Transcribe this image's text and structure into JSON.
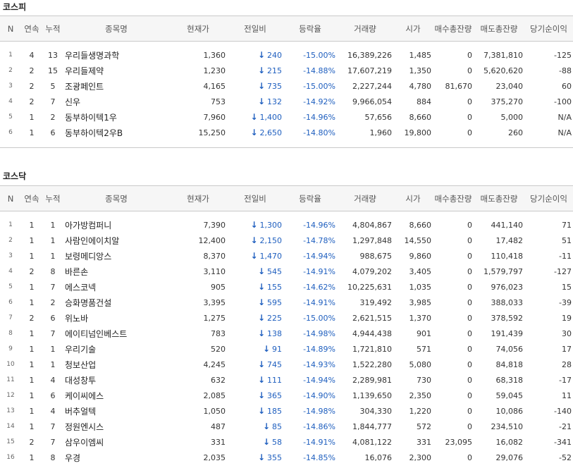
{
  "kospi": {
    "title": "코스피",
    "headers": [
      "N",
      "연속",
      "누적",
      "종목명",
      "현재가",
      "전일비",
      "등락율",
      "거래량",
      "시가",
      "매수총잔량",
      "매도총잔량",
      "당기순이익"
    ],
    "rows": [
      {
        "n": "1",
        "streak": "4",
        "cum": "13",
        "name": "우리들생명과학",
        "price": "1,360",
        "change": "240",
        "rate": "-15.00%",
        "volume": "16,389,226",
        "open": "1,485",
        "bid": "0",
        "ask": "7,381,810",
        "net": "-125"
      },
      {
        "n": "2",
        "streak": "2",
        "cum": "15",
        "name": "우리들제약",
        "price": "1,230",
        "change": "215",
        "rate": "-14.88%",
        "volume": "17,607,219",
        "open": "1,350",
        "bid": "0",
        "ask": "5,620,620",
        "net": "-88"
      },
      {
        "n": "3",
        "streak": "2",
        "cum": "5",
        "name": "조광페인트",
        "price": "4,165",
        "change": "735",
        "rate": "-15.00%",
        "volume": "2,227,244",
        "open": "4,780",
        "bid": "81,670",
        "ask": "23,040",
        "net": "60"
      },
      {
        "n": "4",
        "streak": "2",
        "cum": "7",
        "name": "신우",
        "price": "753",
        "change": "132",
        "rate": "-14.92%",
        "volume": "9,966,054",
        "open": "884",
        "bid": "0",
        "ask": "375,270",
        "net": "-100"
      },
      {
        "n": "5",
        "streak": "1",
        "cum": "2",
        "name": "동부하이텍1우",
        "price": "7,960",
        "change": "1,400",
        "rate": "-14.96%",
        "volume": "57,656",
        "open": "8,660",
        "bid": "0",
        "ask": "5,000",
        "net": "N/A"
      },
      {
        "n": "6",
        "streak": "1",
        "cum": "6",
        "name": "동부하이텍2우B",
        "price": "15,250",
        "change": "2,650",
        "rate": "-14.80%",
        "volume": "1,960",
        "open": "19,800",
        "bid": "0",
        "ask": "260",
        "net": "N/A"
      }
    ]
  },
  "kosdaq": {
    "title": "코스닥",
    "headers": [
      "N",
      "연속",
      "누적",
      "종목명",
      "현재가",
      "전일비",
      "등락율",
      "거래량",
      "시가",
      "매수총잔량",
      "매도총잔량",
      "당기순이익"
    ],
    "rows": [
      {
        "n": "1",
        "streak": "1",
        "cum": "1",
        "name": "아가방컴퍼니",
        "price": "7,390",
        "change": "1,300",
        "rate": "-14.96%",
        "volume": "4,804,867",
        "open": "8,660",
        "bid": "0",
        "ask": "441,140",
        "net": "71"
      },
      {
        "n": "2",
        "streak": "1",
        "cum": "1",
        "name": "사람인에이치알",
        "price": "12,400",
        "change": "2,150",
        "rate": "-14.78%",
        "volume": "1,297,848",
        "open": "14,550",
        "bid": "0",
        "ask": "17,482",
        "net": "51"
      },
      {
        "n": "3",
        "streak": "1",
        "cum": "1",
        "name": "보령메디앙스",
        "price": "8,370",
        "change": "1,470",
        "rate": "-14.94%",
        "volume": "988,675",
        "open": "9,860",
        "bid": "0",
        "ask": "110,418",
        "net": "-11"
      },
      {
        "n": "4",
        "streak": "2",
        "cum": "8",
        "name": "바른손",
        "price": "3,110",
        "change": "545",
        "rate": "-14.91%",
        "volume": "4,079,202",
        "open": "3,405",
        "bid": "0",
        "ask": "1,579,797",
        "net": "-127"
      },
      {
        "n": "5",
        "streak": "1",
        "cum": "7",
        "name": "에스코넥",
        "price": "905",
        "change": "155",
        "rate": "-14.62%",
        "volume": "10,225,631",
        "open": "1,035",
        "bid": "0",
        "ask": "976,023",
        "net": "15"
      },
      {
        "n": "6",
        "streak": "1",
        "cum": "2",
        "name": "승화명품건설",
        "price": "3,395",
        "change": "595",
        "rate": "-14.91%",
        "volume": "319,492",
        "open": "3,985",
        "bid": "0",
        "ask": "388,033",
        "net": "-39"
      },
      {
        "n": "7",
        "streak": "2",
        "cum": "6",
        "name": "위노바",
        "price": "1,275",
        "change": "225",
        "rate": "-15.00%",
        "volume": "2,621,515",
        "open": "1,370",
        "bid": "0",
        "ask": "378,592",
        "net": "19"
      },
      {
        "n": "8",
        "streak": "1",
        "cum": "7",
        "name": "에이티넘인베스트",
        "price": "783",
        "change": "138",
        "rate": "-14.98%",
        "volume": "4,944,438",
        "open": "901",
        "bid": "0",
        "ask": "191,439",
        "net": "30"
      },
      {
        "n": "9",
        "streak": "1",
        "cum": "1",
        "name": "우리기술",
        "price": "520",
        "change": "91",
        "rate": "-14.89%",
        "volume": "1,721,810",
        "open": "571",
        "bid": "0",
        "ask": "74,056",
        "net": "17"
      },
      {
        "n": "10",
        "streak": "1",
        "cum": "1",
        "name": "청보산업",
        "price": "4,245",
        "change": "745",
        "rate": "-14.93%",
        "volume": "1,522,280",
        "open": "5,080",
        "bid": "0",
        "ask": "84,818",
        "net": "28"
      },
      {
        "n": "11",
        "streak": "1",
        "cum": "4",
        "name": "대성창투",
        "price": "632",
        "change": "111",
        "rate": "-14.94%",
        "volume": "2,289,981",
        "open": "730",
        "bid": "0",
        "ask": "68,318",
        "net": "-17"
      },
      {
        "n": "12",
        "streak": "1",
        "cum": "6",
        "name": "케이씨에스",
        "price": "2,085",
        "change": "365",
        "rate": "-14.90%",
        "volume": "1,139,650",
        "open": "2,350",
        "bid": "0",
        "ask": "59,045",
        "net": "11"
      },
      {
        "n": "13",
        "streak": "1",
        "cum": "4",
        "name": "버추얼텍",
        "price": "1,050",
        "change": "185",
        "rate": "-14.98%",
        "volume": "304,330",
        "open": "1,220",
        "bid": "0",
        "ask": "10,086",
        "net": "-140"
      },
      {
        "n": "14",
        "streak": "1",
        "cum": "7",
        "name": "정원엔시스",
        "price": "487",
        "change": "85",
        "rate": "-14.86%",
        "volume": "1,844,777",
        "open": "572",
        "bid": "0",
        "ask": "234,510",
        "net": "-21"
      },
      {
        "n": "15",
        "streak": "2",
        "cum": "7",
        "name": "삼우이엠씨",
        "price": "331",
        "change": "58",
        "rate": "-14.91%",
        "volume": "4,081,122",
        "open": "331",
        "bid": "23,095",
        "ask": "16,082",
        "net": "-341"
      },
      {
        "n": "16",
        "streak": "1",
        "cum": "8",
        "name": "우경",
        "price": "2,035",
        "change": "355",
        "rate": "-14.85%",
        "volume": "16,076",
        "open": "2,300",
        "bid": "0",
        "ask": "29,076",
        "net": "-52"
      }
    ]
  },
  "arrow_color": "#1f5fbf",
  "arrow_icon": "down-arrow-icon"
}
